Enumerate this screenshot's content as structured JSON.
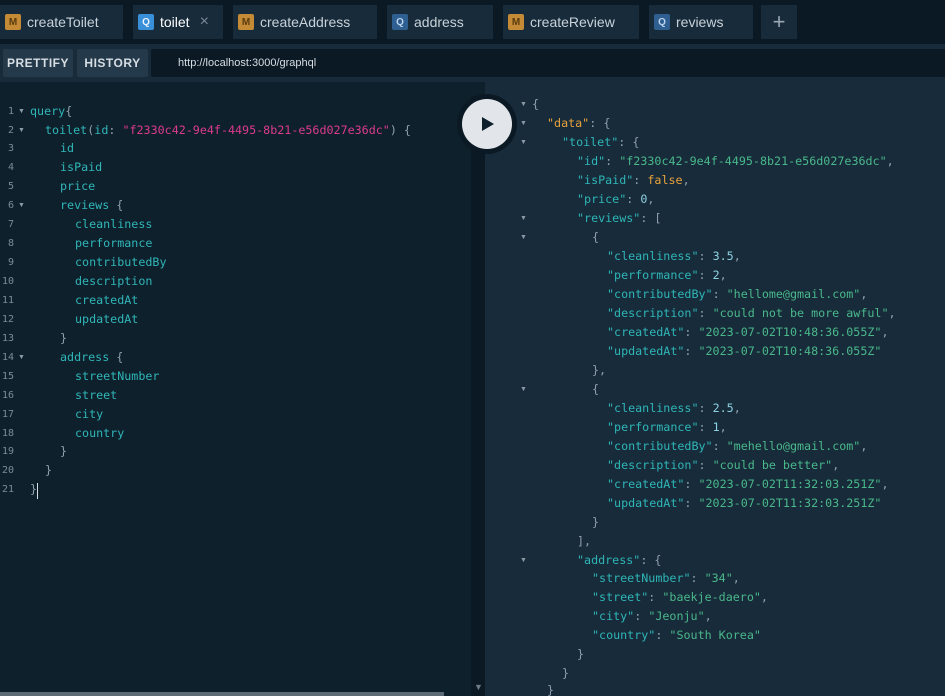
{
  "tabs": [
    {
      "badge": "M",
      "label": "createToilet"
    },
    {
      "badge": "Q",
      "label": "toilet",
      "close": "×"
    },
    {
      "badge": "M",
      "label": "createAddress"
    },
    {
      "badge": "Q",
      "label": "address"
    },
    {
      "badge": "M",
      "label": "createReview"
    },
    {
      "badge": "Q",
      "label": "reviews"
    }
  ],
  "new_tab_label": "+",
  "toolbar": {
    "prettify_label": "PRETTIFY",
    "history_label": "HISTORY",
    "endpoint_url": "http://localhost:3000/graphql"
  },
  "query_editor": {
    "line_numbers": [
      "1",
      "2",
      "3",
      "4",
      "5",
      "6",
      "7",
      "8",
      "9",
      "10",
      "11",
      "12",
      "13",
      "14",
      "15",
      "16",
      "17",
      "18",
      "19",
      "20",
      "21"
    ],
    "keyword": "query",
    "open_brace": "{",
    "root_field": "toilet",
    "arg_open": "(",
    "arg_name": "id",
    "arg_colon": ": ",
    "arg_value": "\"f2330c42-9e4f-4495-8b21-e56d027e36dc\"",
    "arg_close": ")",
    "block_open": " {",
    "fields": {
      "id": "id",
      "isPaid": "isPaid",
      "price": "price",
      "reviews": "reviews",
      "cleanliness": "cleanliness",
      "performance": "performance",
      "contributedBy": "contributedBy",
      "description": "description",
      "createdAt": "createdAt",
      "updatedAt": "updatedAt",
      "address": "address",
      "streetNumber": "streetNumber",
      "street": "street",
      "city": "city",
      "country": "country"
    },
    "close_brace": "}"
  },
  "result": {
    "open_obj": "{",
    "close_obj": "}",
    "open_arr": "[",
    "close_arr": "],",
    "close_obj_comma": "},",
    "colon": ": ",
    "keys": {
      "data": "\"data\"",
      "toilet": "\"toilet\"",
      "id": "\"id\"",
      "isPaid": "\"isPaid\"",
      "price": "\"price\"",
      "reviews": "\"reviews\"",
      "cleanliness": "\"cleanliness\"",
      "performance": "\"performance\"",
      "contributedBy": "\"contributedBy\"",
      "description": "\"description\"",
      "createdAt": "\"createdAt\"",
      "updatedAt": "\"updatedAt\"",
      "address": "\"address\"",
      "streetNumber": "\"streetNumber\"",
      "street": "\"street\"",
      "city": "\"city\"",
      "country": "\"country\""
    },
    "toilet": {
      "id": "\"f2330c42-9e4f-4495-8b21-e56d027e36dc\"",
      "isPaid": "false",
      "price": "0"
    },
    "reviews": [
      {
        "cleanliness": "3.5",
        "performance": "2",
        "contributedBy": "\"hellome@gmail.com\"",
        "description": "\"could not be more awful\"",
        "createdAt": "\"2023-07-02T10:48:36.055Z\"",
        "updatedAt": "\"2023-07-02T10:48:36.055Z\""
      },
      {
        "cleanliness": "2.5",
        "performance": "1",
        "contributedBy": "\"mehello@gmail.com\"",
        "description": "\"could be better\"",
        "createdAt": "\"2023-07-02T11:32:03.251Z\"",
        "updatedAt": "\"2023-07-02T11:32:03.251Z\""
      }
    ],
    "address": {
      "streetNumber": "\"34\"",
      "street": "\"baekje-daero\"",
      "city": "\"Jeonju\"",
      "country": "\"South Korea\""
    }
  },
  "colors": {
    "background": "#0f202d",
    "panel": "#172b3a",
    "accent_cyan": "#2fb6b7",
    "string_pink": "#dc3a8c",
    "string_green": "#4ab88b",
    "data_orange": "#e8a23a"
  },
  "icons": {
    "play": "play-icon",
    "close": "close-icon",
    "fold": "fold-arrow-icon"
  }
}
